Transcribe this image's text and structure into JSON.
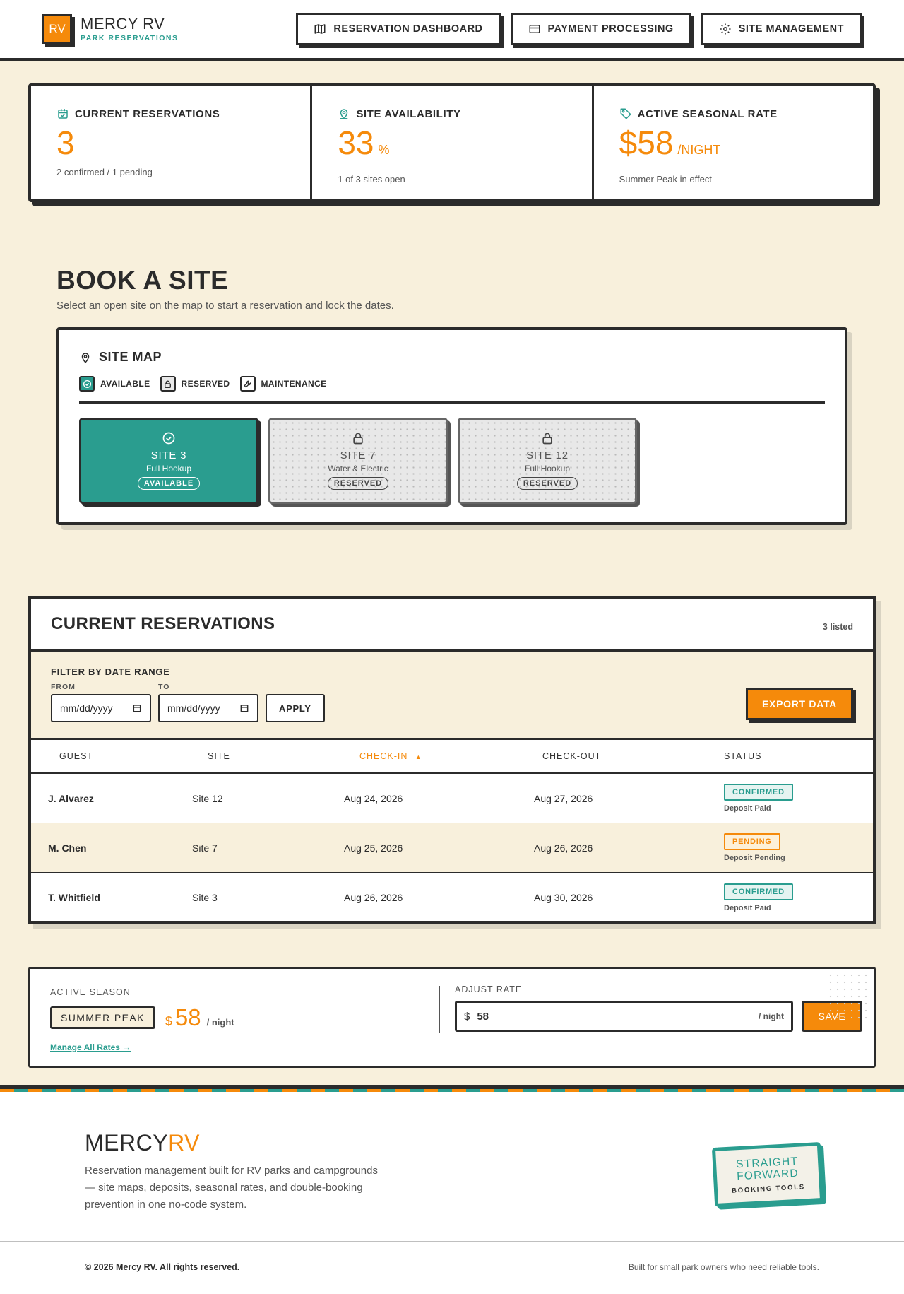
{
  "brand": {
    "logo": "RV",
    "name": "MERCY RV",
    "subtitle": "PARK RESERVATIONS"
  },
  "nav": [
    {
      "label": "RESERVATION DASHBOARD",
      "icon": "map-icon"
    },
    {
      "label": "PAYMENT PROCESSING",
      "icon": "credit-card-icon"
    },
    {
      "label": "SITE MANAGEMENT",
      "icon": "gear-icon"
    }
  ],
  "stats": [
    {
      "label": "CURRENT RESERVATIONS",
      "icon": "calendar-icon",
      "value": "3",
      "unit": "",
      "note": "2 confirmed / 1 pending"
    },
    {
      "label": "SITE AVAILABILITY",
      "icon": "location-pin-icon",
      "value": "33",
      "unit": "%",
      "note": "1 of 3 sites open"
    },
    {
      "label": "ACTIVE SEASONAL RATE",
      "icon": "tag-icon",
      "value": "$58",
      "unit": "/NIGHT",
      "note": "Summer Peak in effect"
    }
  ],
  "book": {
    "title": "BOOK A SITE",
    "subtitle": "Select an open site on the map to start a reservation and lock the dates.",
    "map_title": "SITE MAP",
    "legend": [
      {
        "label": "AVAILABLE",
        "icon": "check-circle-icon"
      },
      {
        "label": "RESERVED",
        "icon": "lock-icon"
      },
      {
        "label": "MAINTENANCE",
        "icon": "wrench-icon"
      }
    ],
    "sites": [
      {
        "name": "SITE 3",
        "type": "Full Hookup",
        "status": "AVAILABLE",
        "icon": "check-circle-icon"
      },
      {
        "name": "SITE 7",
        "type": "Water & Electric",
        "status": "RESERVED",
        "icon": "lock-icon"
      },
      {
        "name": "SITE 12",
        "type": "Full Hookup",
        "status": "RESERVED",
        "icon": "lock-icon"
      }
    ]
  },
  "reservations": {
    "title": "CURRENT RESERVATIONS",
    "count": "3 listed",
    "filter_title": "FILTER BY DATE RANGE",
    "from_label": "FROM",
    "to_label": "TO",
    "date_placeholder": "mm/dd/yyyy",
    "apply_label": "APPLY",
    "export_label": "EXPORT DATA",
    "columns": [
      "GUEST",
      "SITE",
      "CHECK-IN",
      "CHECK-OUT",
      "STATUS"
    ],
    "sort_indicator": "▲",
    "rows": [
      {
        "guest": "J. Alvarez",
        "site": "Site 12",
        "check_in": "Aug 24, 2026",
        "check_out": "Aug 27, 2026",
        "status": "CONFIRMED",
        "note": "Deposit Paid"
      },
      {
        "guest": "M. Chen",
        "site": "Site 7",
        "check_in": "Aug 25, 2026",
        "check_out": "Aug 26, 2026",
        "status": "PENDING",
        "note": "Deposit Pending"
      },
      {
        "guest": "T. Whitfield",
        "site": "Site 3",
        "check_in": "Aug 26, 2026",
        "check_out": "Aug 30, 2026",
        "status": "CONFIRMED",
        "note": "Deposit Paid"
      }
    ]
  },
  "rate": {
    "season_label": "ACTIVE SEASON",
    "season": "SUMMER PEAK",
    "currency": "$",
    "amount": "58",
    "per": "/ night",
    "manage_link": "Manage All Rates →",
    "adjust_label": "ADJUST RATE",
    "input_prefix": "$",
    "input_value": "58",
    "input_suffix": "/ night",
    "save_label": "SAVE"
  },
  "footer": {
    "brand_main": "MERCY",
    "brand_accent": "RV",
    "description": "Reservation management built for RV parks and campgrounds — site maps, deposits, seasonal rates, and double-booking prevention in one no-code system.",
    "stamp_line1": "STRAIGHT",
    "stamp_line2": "FORWARD",
    "stamp_sub": "BOOKING TOOLS",
    "copyright": "© 2026 Mercy RV. All rights reserved.",
    "tagline": "Built for small park owners who need reliable tools."
  },
  "colors": {
    "accent": "#f58a0b",
    "teal": "#2a9d8f",
    "ink": "#2b2b2b",
    "cream": "#f8f0dc"
  }
}
